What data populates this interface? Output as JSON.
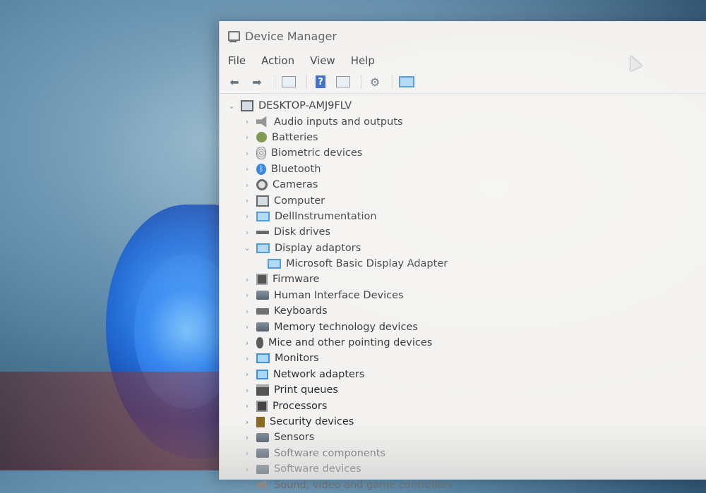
{
  "window": {
    "title": "Device Manager"
  },
  "menu": [
    "File",
    "Action",
    "View",
    "Help"
  ],
  "toolbar": {
    "icons": [
      "back-arrow-icon",
      "forward-arrow-icon",
      "show-hide-console-tree-icon",
      "help-icon",
      "properties-pane-icon",
      "update-driver-icon",
      "scan-hardware-changes-icon"
    ]
  },
  "tree": {
    "root": "DESKTOP-AMJ9FLV",
    "categories": [
      {
        "label": "Audio inputs and outputs",
        "icon": "audio-icon",
        "expanded": false
      },
      {
        "label": "Batteries",
        "icon": "battery-icon",
        "expanded": false
      },
      {
        "label": "Biometric devices",
        "icon": "fingerprint-icon",
        "expanded": false
      },
      {
        "label": "Bluetooth",
        "icon": "bluetooth-icon",
        "expanded": false
      },
      {
        "label": "Cameras",
        "icon": "camera-icon",
        "expanded": false
      },
      {
        "label": "Computer",
        "icon": "computer-icon",
        "expanded": false
      },
      {
        "label": "DellInstrumentation",
        "icon": "monitor-icon",
        "expanded": false
      },
      {
        "label": "Disk drives",
        "icon": "disk-icon",
        "expanded": false
      },
      {
        "label": "Display adaptors",
        "icon": "display-adapter-icon",
        "expanded": true,
        "children": [
          "Microsoft Basic Display Adapter"
        ]
      },
      {
        "label": "Firmware",
        "icon": "chip-icon",
        "expanded": false
      },
      {
        "label": "Human Interface Devices",
        "icon": "hid-icon",
        "expanded": false
      },
      {
        "label": "Keyboards",
        "icon": "keyboard-icon",
        "expanded": false
      },
      {
        "label": "Memory technology devices",
        "icon": "memory-icon",
        "expanded": false
      },
      {
        "label": "Mice and other pointing devices",
        "icon": "mouse-icon",
        "expanded": false
      },
      {
        "label": "Monitors",
        "icon": "monitor-icon",
        "expanded": false
      },
      {
        "label": "Network adapters",
        "icon": "network-icon",
        "expanded": false
      },
      {
        "label": "Print queues",
        "icon": "printer-icon",
        "expanded": false
      },
      {
        "label": "Processors",
        "icon": "processor-icon",
        "expanded": false
      },
      {
        "label": "Security devices",
        "icon": "security-icon",
        "expanded": false
      },
      {
        "label": "Sensors",
        "icon": "sensor-icon",
        "expanded": false
      },
      {
        "label": "Software components",
        "icon": "software-icon",
        "expanded": false
      },
      {
        "label": "Software devices",
        "icon": "software-icon",
        "expanded": false
      },
      {
        "label": "Sound, video and game controllers",
        "icon": "sound-icon",
        "expanded": false
      }
    ]
  }
}
